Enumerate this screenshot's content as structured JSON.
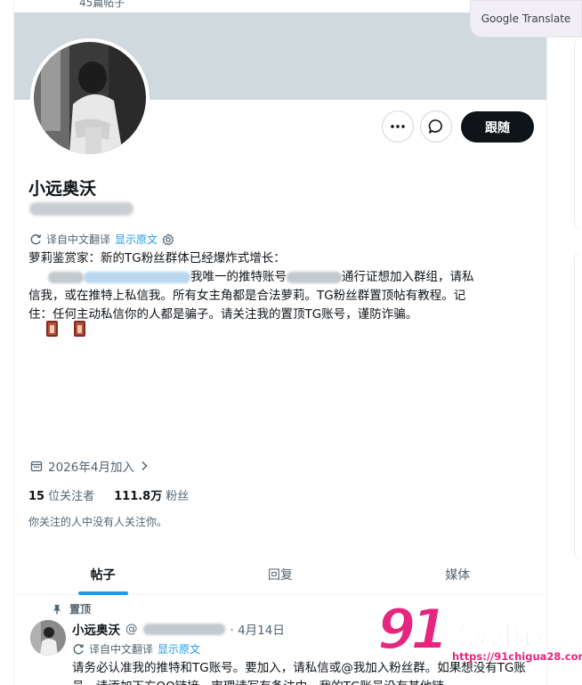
{
  "header": {
    "post_count": "45篇帖子"
  },
  "google_translate": {
    "label": "Google Translate"
  },
  "profile": {
    "name": "小远奥沃",
    "follow_label": "跟随",
    "translated_from": "译自中文翻译",
    "show_original": "显示原文",
    "bio": {
      "line1": "萝莉鉴赏家：新的TG粉丝群体已经爆炸式增长：",
      "line2_after_link": "我唯一的推特账号",
      "line2_end": "通行证想加入群组，请私",
      "line3": "信我，或在推特上私信我。所有女主角都是合法萝莉。TG粉丝群置顶帖有教程。记",
      "line4": "住：任何主动私信你的人都是骗子。请关注我的置顶TG账号，谨防诈骗。"
    },
    "joined": "2026年4月加入",
    "following_count": "15",
    "following_label": "位关注者",
    "followers_count": "111.8万",
    "followers_label": "粉丝",
    "mutual_note": "你关注的人中没有人关注你。"
  },
  "tabs": [
    {
      "label": "帖子",
      "active": true
    },
    {
      "label": "回复",
      "active": false
    },
    {
      "label": "媒体",
      "active": false
    }
  ],
  "pinned_tweet": {
    "pinned_label": "置顶",
    "author": "小远奥沃",
    "handle_prefix": "@",
    "date": "· 4月14日",
    "translated_from": "译自中文翻译",
    "show_original": "显示原文",
    "text": "请务必认准我的推特和TG账号。要加入，请私信或@我加入粉丝群。如果想没有TG账号，请添加下方QQ链接。审理请写有备注中，我的TG账号没有其他链"
  },
  "watermark": {
    "number": "91",
    "text": "吃瓜中心",
    "url": "https://91chigua28.com/"
  }
}
